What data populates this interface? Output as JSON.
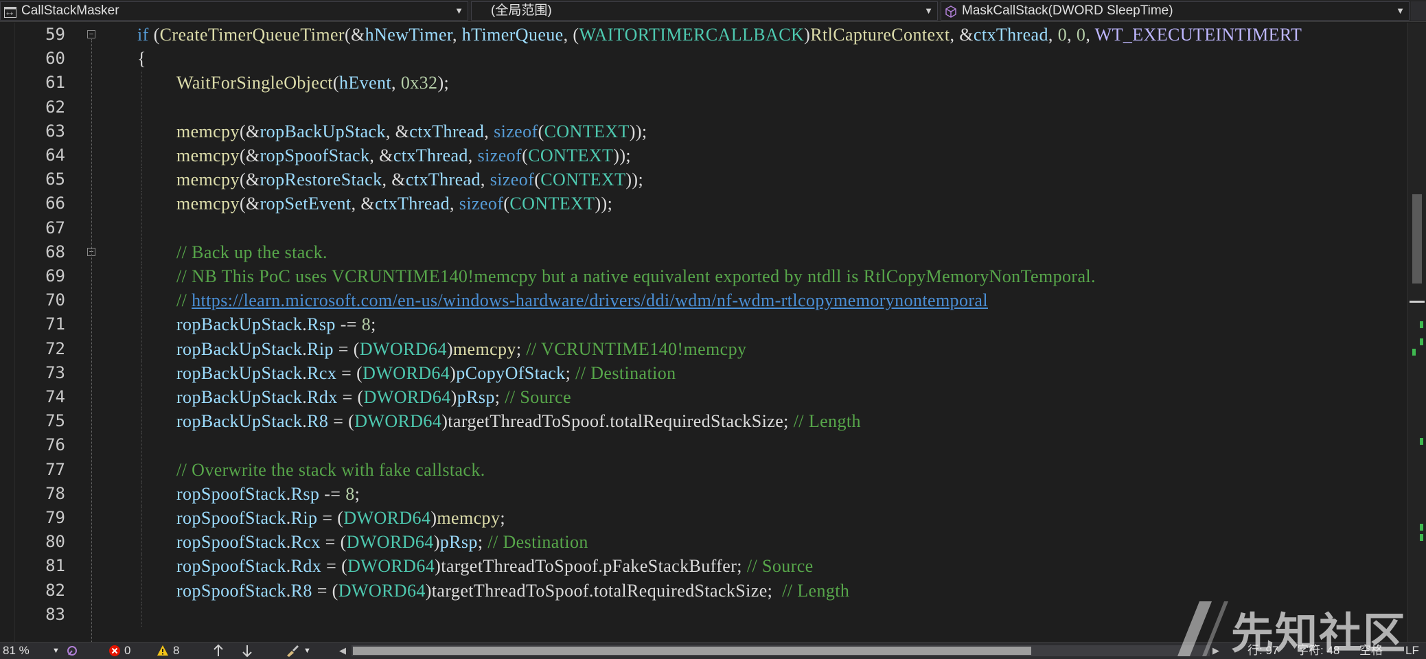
{
  "navbar": {
    "project": "CallStackMasker",
    "scope": "(全局范围)",
    "function": "MaskCallStack(DWORD SleepTime)"
  },
  "code": {
    "lines": [
      {
        "n": "59",
        "fold": true,
        "indent": 1,
        "tokens": [
          [
            "kw",
            "if"
          ],
          [
            "pl",
            " ("
          ],
          [
            "fn",
            "CreateTimerQueueTimer"
          ],
          [
            "pl",
            "(&"
          ],
          [
            "var",
            "hNewTimer"
          ],
          [
            "pl",
            ", "
          ],
          [
            "var",
            "hTimerQueue"
          ],
          [
            "pl",
            ", ("
          ],
          [
            "ty",
            "WAITORTIMERCALLBACK"
          ],
          [
            "pl",
            ")"
          ],
          [
            "fn",
            "RtlCaptureContext"
          ],
          [
            "pl",
            ", &"
          ],
          [
            "var",
            "ctxThread"
          ],
          [
            "pl",
            ", "
          ],
          [
            "num",
            "0"
          ],
          [
            "pl",
            ", "
          ],
          [
            "num",
            "0"
          ],
          [
            "pl",
            ", "
          ],
          [
            "mac",
            "WT_EXECUTEINTIMERT"
          ]
        ]
      },
      {
        "n": "60",
        "indent": 1,
        "tokens": [
          [
            "pl",
            "{"
          ]
        ]
      },
      {
        "n": "61",
        "indent": 2,
        "tokens": [
          [
            "fn",
            "WaitForSingleObject"
          ],
          [
            "pl",
            "("
          ],
          [
            "var",
            "hEvent"
          ],
          [
            "pl",
            ", "
          ],
          [
            "num",
            "0x32"
          ],
          [
            "pl",
            ");"
          ]
        ]
      },
      {
        "n": "62",
        "indent": 2,
        "tokens": []
      },
      {
        "n": "63",
        "indent": 2,
        "tokens": [
          [
            "fn",
            "memcpy"
          ],
          [
            "pl",
            "(&"
          ],
          [
            "var",
            "ropBackUpStack"
          ],
          [
            "pl",
            ", &"
          ],
          [
            "var",
            "ctxThread"
          ],
          [
            "pl",
            ", "
          ],
          [
            "kw",
            "sizeof"
          ],
          [
            "pl",
            "("
          ],
          [
            "ty",
            "CONTEXT"
          ],
          [
            "pl",
            "));"
          ]
        ]
      },
      {
        "n": "64",
        "indent": 2,
        "tokens": [
          [
            "fn",
            "memcpy"
          ],
          [
            "pl",
            "(&"
          ],
          [
            "var",
            "ropSpoofStack"
          ],
          [
            "pl",
            ", &"
          ],
          [
            "var",
            "ctxThread"
          ],
          [
            "pl",
            ", "
          ],
          [
            "kw",
            "sizeof"
          ],
          [
            "pl",
            "("
          ],
          [
            "ty",
            "CONTEXT"
          ],
          [
            "pl",
            "));"
          ]
        ]
      },
      {
        "n": "65",
        "indent": 2,
        "tokens": [
          [
            "fn",
            "memcpy"
          ],
          [
            "pl",
            "(&"
          ],
          [
            "var",
            "ropRestoreStack"
          ],
          [
            "pl",
            ", &"
          ],
          [
            "var",
            "ctxThread"
          ],
          [
            "pl",
            ", "
          ],
          [
            "kw",
            "sizeof"
          ],
          [
            "pl",
            "("
          ],
          [
            "ty",
            "CONTEXT"
          ],
          [
            "pl",
            "));"
          ]
        ]
      },
      {
        "n": "66",
        "indent": 2,
        "tokens": [
          [
            "fn",
            "memcpy"
          ],
          [
            "pl",
            "(&"
          ],
          [
            "var",
            "ropSetEvent"
          ],
          [
            "pl",
            ", &"
          ],
          [
            "var",
            "ctxThread"
          ],
          [
            "pl",
            ", "
          ],
          [
            "kw",
            "sizeof"
          ],
          [
            "pl",
            "("
          ],
          [
            "ty",
            "CONTEXT"
          ],
          [
            "pl",
            "));"
          ]
        ]
      },
      {
        "n": "67",
        "indent": 2,
        "tokens": []
      },
      {
        "n": "68",
        "fold": true,
        "indent": 2,
        "tokens": [
          [
            "cm",
            "// Back up the stack."
          ]
        ]
      },
      {
        "n": "69",
        "indent": 2,
        "tokens": [
          [
            "cm",
            "// NB This PoC uses VCRUNTIME140!memcpy but a native equivalent exported by ntdll is RtlCopyMemoryNonTemporal."
          ]
        ]
      },
      {
        "n": "70",
        "indent": 2,
        "tokens": [
          [
            "cm",
            "// "
          ],
          [
            "lnk",
            "https://learn.microsoft.com/en-us/windows-hardware/drivers/ddi/wdm/nf-wdm-rtlcopymemorynontemporal"
          ]
        ]
      },
      {
        "n": "71",
        "indent": 2,
        "tokens": [
          [
            "var",
            "ropBackUpStack"
          ],
          [
            "pl",
            "."
          ],
          [
            "var",
            "Rsp"
          ],
          [
            "pl",
            " -= "
          ],
          [
            "num",
            "8"
          ],
          [
            "pl",
            ";"
          ]
        ]
      },
      {
        "n": "72",
        "indent": 2,
        "tokens": [
          [
            "var",
            "ropBackUpStack"
          ],
          [
            "pl",
            "."
          ],
          [
            "var",
            "Rip"
          ],
          [
            "pl",
            " = ("
          ],
          [
            "ty",
            "DWORD64"
          ],
          [
            "pl",
            ")"
          ],
          [
            "fn",
            "memcpy"
          ],
          [
            "pl",
            "; "
          ],
          [
            "cm",
            "// VCRUNTIME140!memcpy"
          ]
        ]
      },
      {
        "n": "73",
        "indent": 2,
        "tokens": [
          [
            "var",
            "ropBackUpStack"
          ],
          [
            "pl",
            "."
          ],
          [
            "var",
            "Rcx"
          ],
          [
            "pl",
            " = ("
          ],
          [
            "ty",
            "DWORD64"
          ],
          [
            "pl",
            ")"
          ],
          [
            "var",
            "pCopyOfStack"
          ],
          [
            "pl",
            "; "
          ],
          [
            "cm",
            "// Destination"
          ]
        ]
      },
      {
        "n": "74",
        "indent": 2,
        "tokens": [
          [
            "var",
            "ropBackUpStack"
          ],
          [
            "pl",
            "."
          ],
          [
            "var",
            "Rdx"
          ],
          [
            "pl",
            " = ("
          ],
          [
            "ty",
            "DWORD64"
          ],
          [
            "pl",
            ")"
          ],
          [
            "var",
            "pRsp"
          ],
          [
            "pl",
            "; "
          ],
          [
            "cm",
            "// Source"
          ]
        ]
      },
      {
        "n": "75",
        "indent": 2,
        "tokens": [
          [
            "var",
            "ropBackUpStack"
          ],
          [
            "pl",
            "."
          ],
          [
            "var",
            "R8"
          ],
          [
            "pl",
            " = ("
          ],
          [
            "ty",
            "DWORD64"
          ],
          [
            "pl",
            ")targetThreadToSpoof.totalRequiredStackSize; "
          ],
          [
            "cm",
            "// Length"
          ]
        ]
      },
      {
        "n": "76",
        "indent": 2,
        "tokens": []
      },
      {
        "n": "77",
        "indent": 2,
        "tokens": [
          [
            "cm",
            "// Overwrite the stack with fake callstack."
          ]
        ]
      },
      {
        "n": "78",
        "indent": 2,
        "tokens": [
          [
            "var",
            "ropSpoofStack"
          ],
          [
            "pl",
            "."
          ],
          [
            "var",
            "Rsp"
          ],
          [
            "pl",
            " -= "
          ],
          [
            "num",
            "8"
          ],
          [
            "pl",
            ";"
          ]
        ]
      },
      {
        "n": "79",
        "indent": 2,
        "tokens": [
          [
            "var",
            "ropSpoofStack"
          ],
          [
            "pl",
            "."
          ],
          [
            "var",
            "Rip"
          ],
          [
            "pl",
            " = ("
          ],
          [
            "ty",
            "DWORD64"
          ],
          [
            "pl",
            ")"
          ],
          [
            "fn",
            "memcpy"
          ],
          [
            "pl",
            ";"
          ]
        ]
      },
      {
        "n": "80",
        "indent": 2,
        "tokens": [
          [
            "var",
            "ropSpoofStack"
          ],
          [
            "pl",
            "."
          ],
          [
            "var",
            "Rcx"
          ],
          [
            "pl",
            " = ("
          ],
          [
            "ty",
            "DWORD64"
          ],
          [
            "pl",
            ")"
          ],
          [
            "var",
            "pRsp"
          ],
          [
            "pl",
            "; "
          ],
          [
            "cm",
            "// Destination"
          ]
        ]
      },
      {
        "n": "81",
        "indent": 2,
        "tokens": [
          [
            "var",
            "ropSpoofStack"
          ],
          [
            "pl",
            "."
          ],
          [
            "var",
            "Rdx"
          ],
          [
            "pl",
            " = ("
          ],
          [
            "ty",
            "DWORD64"
          ],
          [
            "pl",
            ")targetThreadToSpoof.pFakeStackBuffer; "
          ],
          [
            "cm",
            "// Source"
          ]
        ]
      },
      {
        "n": "82",
        "indent": 2,
        "tokens": [
          [
            "var",
            "ropSpoofStack"
          ],
          [
            "pl",
            "."
          ],
          [
            "var",
            "R8"
          ],
          [
            "pl",
            " = ("
          ],
          [
            "ty",
            "DWORD64"
          ],
          [
            "pl",
            ")targetThreadToSpoof.totalRequiredStackSize;  "
          ],
          [
            "cm",
            "// Length"
          ]
        ]
      },
      {
        "n": "83",
        "indent": 2,
        "tokens": []
      }
    ]
  },
  "statusbar": {
    "zoom": "81 %",
    "errors": "0",
    "warnings": "8",
    "line": "行: 97",
    "char": "字符: 48",
    "whitespace": "空格",
    "eol": "LF"
  },
  "watermark": {
    "text": "先知社区"
  },
  "colors": {
    "background": "#1e1e1e",
    "keyword": "#569cd6",
    "function": "#dcdcaa",
    "variable": "#9cdcfe",
    "type": "#4ec9b0",
    "number": "#b5cea8",
    "comment": "#57a64a",
    "link": "#4a8fd6",
    "macro": "#beb7ff"
  }
}
